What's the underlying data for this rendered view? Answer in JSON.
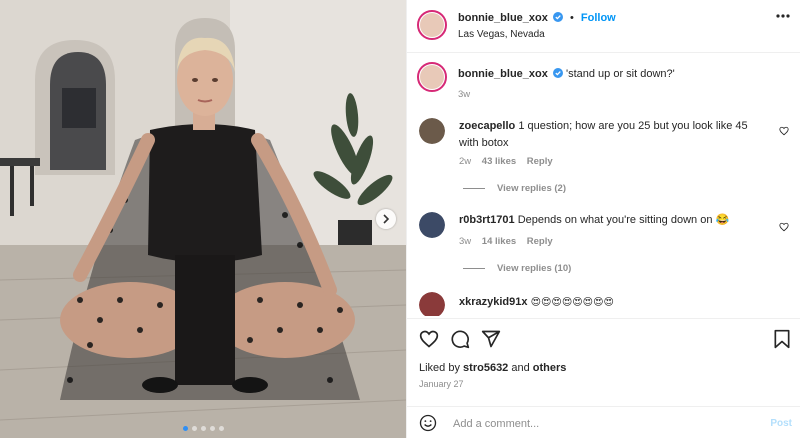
{
  "post": {
    "author": "bonnie_blue_xox",
    "follow_label": "Follow",
    "separator": "•",
    "location": "Las Vegas, Nevada",
    "caption": "'stand up or sit down?'",
    "caption_age": "3w",
    "carousel": {
      "slide_count": 5,
      "active_slide": 1
    }
  },
  "comments": [
    {
      "user": "zoecapello",
      "text": "1 question; how are you 25 but you look like 45 with botox",
      "age": "2w",
      "likes": "43 likes",
      "reply_label": "Reply",
      "view_replies": "View replies (2)"
    },
    {
      "user": "r0b3rt1701",
      "text": "Depends on what you're sitting down on 😂",
      "age": "3w",
      "likes": "14 likes",
      "reply_label": "Reply",
      "view_replies": "View replies (10)"
    },
    {
      "user": "xkrazykid91x",
      "text": "😍😍😍😍😍😍😍😍"
    }
  ],
  "footer": {
    "liked_prefix": "Liked by",
    "liked_user": "stro5632",
    "liked_and": "and",
    "liked_others": "others",
    "date": "January 27",
    "comment_placeholder": "Add a comment...",
    "post_label": "Post"
  },
  "icons": {
    "verified": "verified-badge-icon",
    "more": "more-options-icon",
    "like": "heart-icon",
    "comment": "comment-icon",
    "share": "share-icon",
    "save": "bookmark-icon",
    "emoji": "emoji-icon",
    "next": "chevron-right-icon"
  },
  "colors": {
    "accent": "#0095f6",
    "verified": "#3897f0",
    "story_ring": "#d62976",
    "muted": "#8e8e8e"
  }
}
